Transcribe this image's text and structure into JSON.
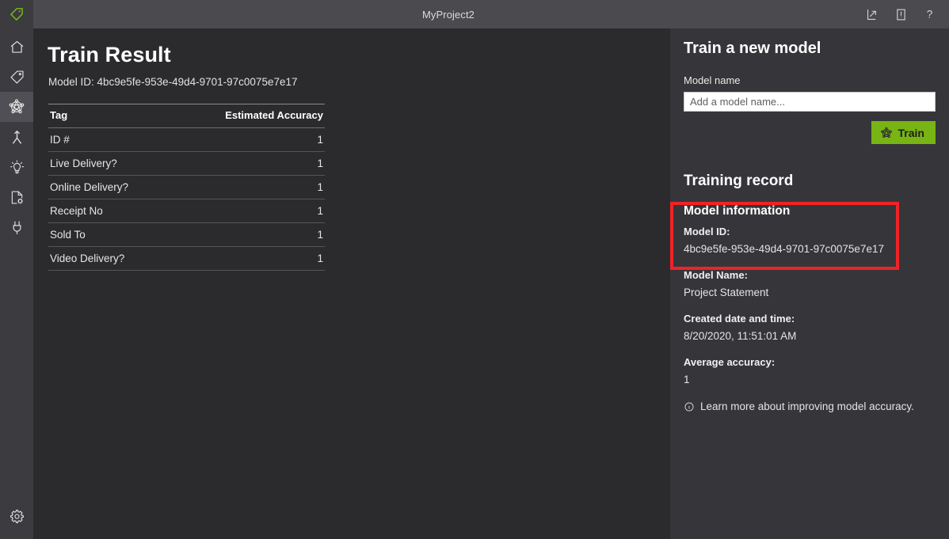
{
  "titlebar": {
    "project_title": "MyProject2",
    "logo_icon": "tag-logo-icon",
    "actions": [
      {
        "name": "share-icon",
        "label": "Share"
      },
      {
        "name": "book-icon",
        "label": "Documentation"
      },
      {
        "name": "help-icon",
        "label": "Help"
      }
    ]
  },
  "sidebar": {
    "items": [
      {
        "name": "sidebar-item-home",
        "icon": "home-icon",
        "label": "Home",
        "active": false
      },
      {
        "name": "sidebar-item-tag",
        "icon": "tag-icon",
        "label": "Tag",
        "active": false
      },
      {
        "name": "sidebar-item-train",
        "icon": "model-network-icon",
        "label": "Train",
        "active": true
      },
      {
        "name": "sidebar-item-analyze",
        "icon": "person-icon",
        "label": "Analyze",
        "active": false
      },
      {
        "name": "sidebar-item-predict",
        "icon": "lightbulb-icon",
        "label": "Predict",
        "active": false
      },
      {
        "name": "sidebar-item-compose",
        "icon": "document-settings-icon",
        "label": "Compose",
        "active": false
      },
      {
        "name": "sidebar-item-connections",
        "icon": "plug-icon",
        "label": "Connections",
        "active": false
      }
    ],
    "settings": {
      "name": "sidebar-item-settings",
      "icon": "gear-icon",
      "label": "Settings"
    }
  },
  "main": {
    "page_title": "Train Result",
    "model_id_line": "Model ID: 4bc9e5fe-953e-49d4-9701-97c0075e7e17",
    "table": {
      "columns": [
        "Tag",
        "Estimated Accuracy"
      ],
      "rows": [
        {
          "tag": "ID #",
          "accuracy": "1"
        },
        {
          "tag": "Live Delivery?",
          "accuracy": "1"
        },
        {
          "tag": "Online Delivery?",
          "accuracy": "1"
        },
        {
          "tag": "Receipt No",
          "accuracy": "1"
        },
        {
          "tag": "Sold To",
          "accuracy": "1"
        },
        {
          "tag": "Video Delivery?",
          "accuracy": "1"
        }
      ]
    }
  },
  "right_panel": {
    "train_heading": "Train a new model",
    "model_name_label": "Model name",
    "model_name_value": "",
    "model_name_placeholder": "Add a model name...",
    "train_button_label": "Train",
    "train_button_icon": "model-network-icon",
    "training_record_heading": "Training record",
    "model_information": {
      "heading": "Model information",
      "model_id_key": "Model ID:",
      "model_id_value": "4bc9e5fe-953e-49d4-9701-97c0075e7e17",
      "model_name_key": "Model Name:",
      "model_name_value": "Project Statement",
      "created_key": "Created date and time:",
      "created_value": "8/20/2020, 11:51:01 AM",
      "accuracy_key": "Average accuracy:",
      "accuracy_value": "1"
    },
    "learn_more": {
      "icon": "info-icon",
      "text": "Learn more about improving model accuracy."
    }
  },
  "colors": {
    "accent_green": "#78b414",
    "highlight_red": "#ef2326",
    "panel_bg": "#36363a",
    "main_bg": "#2b2b2e",
    "rail_bg": "#3b3b40",
    "titlebar_bg": "#4a4a4f"
  }
}
